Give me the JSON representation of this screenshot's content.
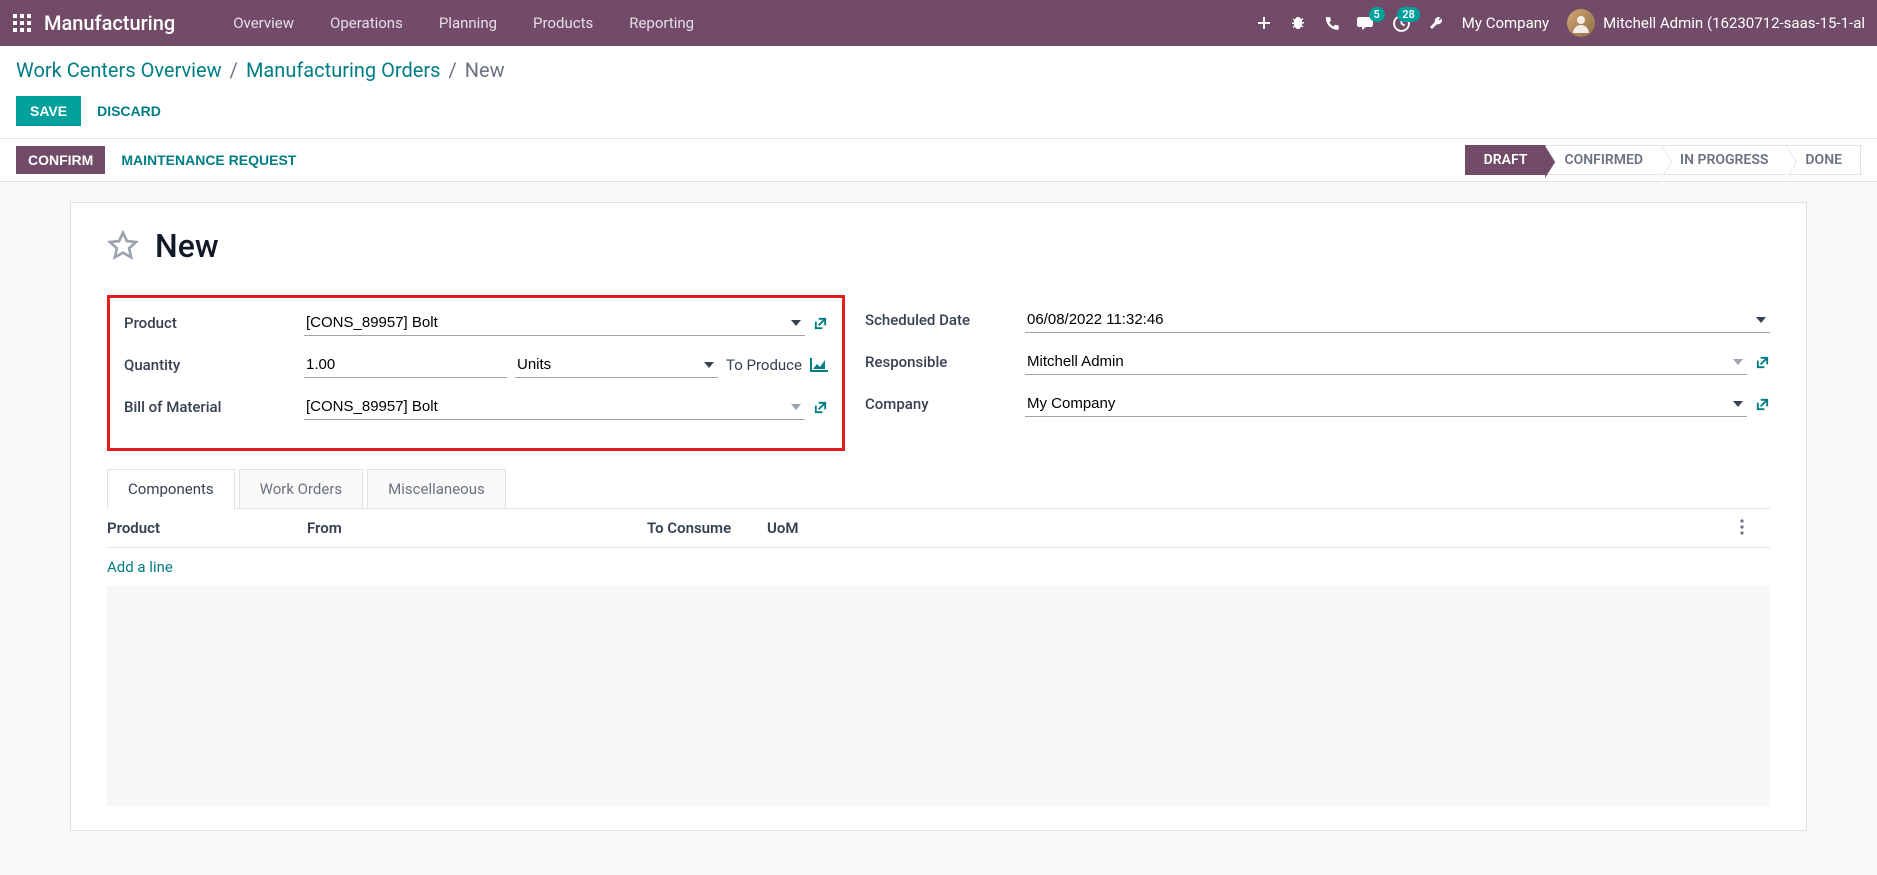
{
  "topbar": {
    "brand": "Manufacturing",
    "menu": [
      "Overview",
      "Operations",
      "Planning",
      "Products",
      "Reporting"
    ],
    "badges": {
      "messages": "5",
      "activities": "28"
    },
    "company": "My Company",
    "user": "Mitchell Admin (16230712-saas-15-1-al"
  },
  "breadcrumbs": {
    "items": [
      "Work Centers Overview",
      "Manufacturing Orders"
    ],
    "current": "New"
  },
  "actions": {
    "save": "SAVE",
    "discard": "DISCARD"
  },
  "statusbar": {
    "confirm": "CONFIRM",
    "maintenance": "MAINTENANCE REQUEST",
    "steps": [
      "DRAFT",
      "CONFIRMED",
      "IN PROGRESS",
      "DONE"
    ],
    "active_step": 0
  },
  "form": {
    "title": "New",
    "left": {
      "product_label": "Product",
      "product_value": "[CONS_89957] Bolt",
      "quantity_label": "Quantity",
      "quantity_value": "1.00",
      "quantity_uom": "Units",
      "to_produce": "To Produce",
      "bom_label": "Bill of Material",
      "bom_value": "[CONS_89957] Bolt"
    },
    "right": {
      "scheduled_label": "Scheduled Date",
      "scheduled_value": "06/08/2022 11:32:46",
      "responsible_label": "Responsible",
      "responsible_value": "Mitchell Admin",
      "company_label": "Company",
      "company_value": "My Company"
    }
  },
  "tabs": [
    "Components",
    "Work Orders",
    "Miscellaneous"
  ],
  "table": {
    "headers": {
      "product": "Product",
      "from": "From",
      "consume": "To Consume",
      "uom": "UoM"
    },
    "add_line": "Add a line"
  }
}
